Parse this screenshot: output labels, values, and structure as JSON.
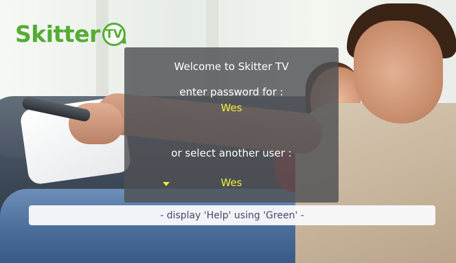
{
  "logo": {
    "brand_text": "Skitter",
    "badge_text": "TV",
    "brand_color": "#54ad33"
  },
  "dialog": {
    "welcome": "Welcome to Skitter TV",
    "password_prompt": "enter password for :",
    "current_user": "Wes",
    "select_prompt": "or select another user :",
    "selected_user": "Wes",
    "highlight_color": "#f2ec3a"
  },
  "help_bar": {
    "text": "- display 'Help' using 'Green' -"
  }
}
